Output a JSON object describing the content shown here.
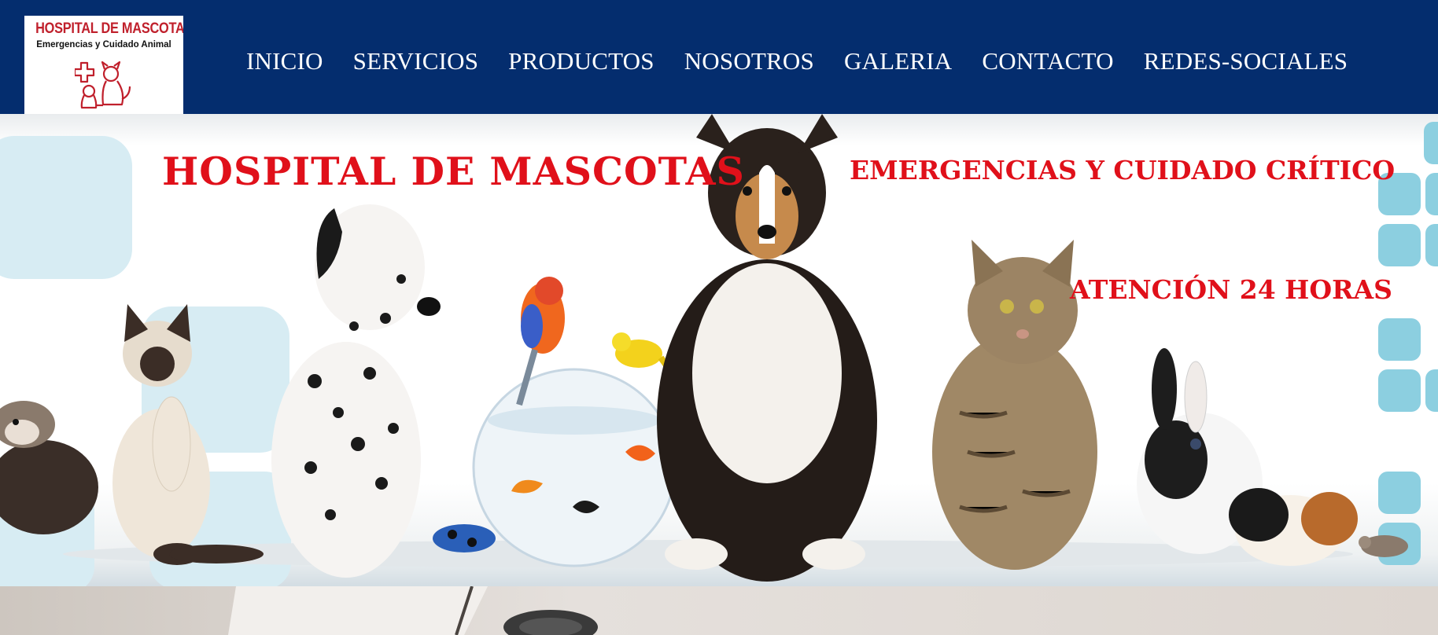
{
  "logo": {
    "title": "HOSPITAL DE MASCOTAS",
    "subtitle": "Emergencias y Cuidado Animal",
    "icon": "pet-medical-icon"
  },
  "nav": {
    "items": [
      {
        "label": "INICIO"
      },
      {
        "label": "SERVICIOS"
      },
      {
        "label": "PRODUCTOS"
      },
      {
        "label": "NOSOTROS"
      },
      {
        "label": "GALERIA"
      },
      {
        "label": "CONTACTO"
      },
      {
        "label": "REDES-SOCIALES"
      }
    ]
  },
  "hero": {
    "title": "HOSPITAL DE MASCOTAS",
    "subtitle_1": "EMERGENCIAS Y CUIDADO CRÍTICO",
    "subtitle_2": "ATENCIÓN 24 HORAS",
    "image": "pets-group-photo"
  },
  "colors": {
    "header_bg": "#042d6e",
    "accent_red": "#e0101a",
    "logo_red": "#c0202c",
    "decor_blue": "#8ccfe0"
  }
}
